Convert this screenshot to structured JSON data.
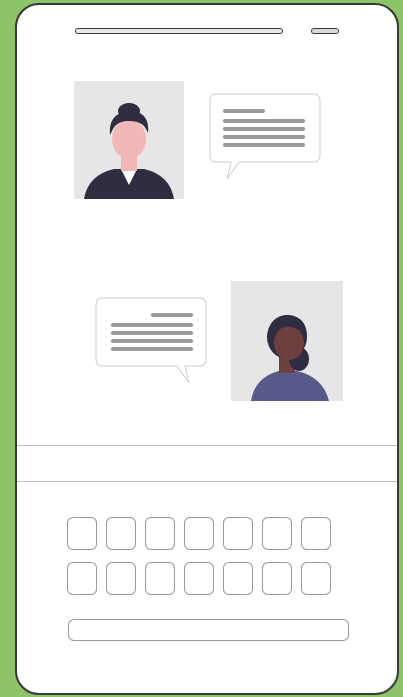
{
  "illustration": {
    "description_icon": "chat-conversation-illustration",
    "colors": {
      "background": "#8cc46a",
      "phone_body": "#ffffff",
      "outline": "#3a3a3a",
      "photo_bg": "#e6e6e6",
      "skin_light": "#f2b8b8",
      "skin_dark": "#6e3f3f",
      "hair": "#2f2e41",
      "jacket": "#2f2e41",
      "shirt_purple": "#575a89",
      "text_lines": "#9a9a9a"
    }
  },
  "keyboard": {
    "row1_keys": 7,
    "row2_keys": 7
  }
}
